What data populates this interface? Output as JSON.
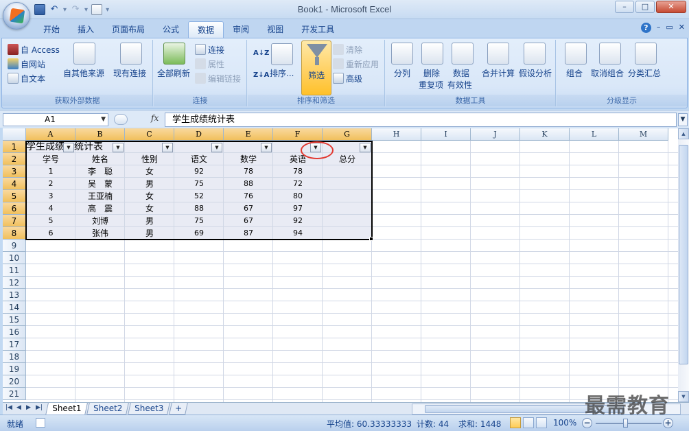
{
  "window": {
    "title": "Book1 - Microsoft Excel"
  },
  "quick_access": {
    "separator": "▾"
  },
  "tabs": [
    {
      "label": "开始"
    },
    {
      "label": "插入"
    },
    {
      "label": "页面布局"
    },
    {
      "label": "公式"
    },
    {
      "label": "数据",
      "active": true
    },
    {
      "label": "审阅"
    },
    {
      "label": "视图"
    },
    {
      "label": "开发工具"
    }
  ],
  "ribbon": {
    "groups": {
      "external": "获取外部数据",
      "connections": "连接",
      "sort_filter": "排序和筛选",
      "data_tools": "数据工具",
      "outline": "分级显示"
    },
    "external": {
      "access": "自 Access",
      "web": "自网站",
      "text": "自文本",
      "other": "自其他来源",
      "existing": "现有连接"
    },
    "connections": {
      "refresh_all": "全部刷新",
      "connections": "连接",
      "properties": "属性",
      "edit_links": "编辑链接"
    },
    "sort_filter": {
      "sort": "排序...",
      "filter": "筛选",
      "clear": "清除",
      "reapply": "重新应用",
      "advanced": "高级"
    },
    "data_tools": {
      "text_to_columns": "分列",
      "remove_dup_1": "删除",
      "remove_dup_2": "重复项",
      "validation_1": "数据",
      "validation_2": "有效性",
      "consolidate": "合并计算",
      "whatif": "假设分析"
    },
    "outline": {
      "group": "组合",
      "ungroup": "取消组合",
      "subtotal": "分类汇总"
    }
  },
  "formula_bar": {
    "name_box": "A1",
    "fx": "fx",
    "content": "学生成绩统计表"
  },
  "columns": [
    "A",
    "B",
    "C",
    "D",
    "E",
    "F",
    "G",
    "H",
    "I",
    "J",
    "K",
    "L",
    "M"
  ],
  "rows": [
    "1",
    "2",
    "3",
    "4",
    "5",
    "6",
    "7",
    "8",
    "9",
    "10",
    "11",
    "12",
    "13",
    "14",
    "15",
    "16",
    "17",
    "18",
    "19",
    "20",
    "21"
  ],
  "sheet": {
    "title_left": "学生成绩",
    "title_right": "统计表",
    "headers": [
      "学号",
      "姓名",
      "性别",
      "语文",
      "数学",
      "英语",
      "总分"
    ],
    "data": [
      [
        "1",
        "李　聪",
        "女",
        "92",
        "78",
        "78",
        ""
      ],
      [
        "2",
        "吴　蒙",
        "男",
        "75",
        "88",
        "72",
        ""
      ],
      [
        "3",
        "王亚楠",
        "女",
        "52",
        "76",
        "80",
        ""
      ],
      [
        "4",
        "高　震",
        "女",
        "88",
        "67",
        "97",
        ""
      ],
      [
        "5",
        "刘博",
        "男",
        "75",
        "67",
        "92",
        ""
      ],
      [
        "6",
        "张伟",
        "男",
        "69",
        "87",
        "94",
        ""
      ]
    ]
  },
  "sheet_tabs": [
    "Sheet1",
    "Sheet2",
    "Sheet3"
  ],
  "status": {
    "ready": "就绪",
    "average": "平均值: 60.33333333",
    "count": "计数: 44",
    "sum": "求和: 1448",
    "zoom": "100%"
  },
  "watermark": "最需教育"
}
